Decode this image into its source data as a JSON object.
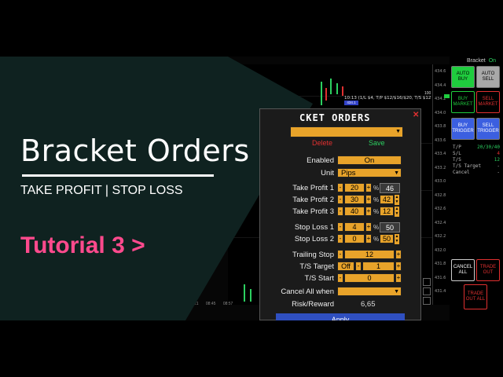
{
  "overlay": {
    "title": "Bracket Orders",
    "subtitle": "TAKE PROFIT | STOP LOSS",
    "tutorial": "Tutorial 3 >",
    "tutorial_color": "#ff4a8d",
    "bg_color": "#0f2220"
  },
  "chart": {
    "status_line": "10:13 (1/L $4, T/P $12/$16/$20, T/S $12",
    "tag": "434.1",
    "price_100": "100",
    "prices": [
      "434.6",
      "434.4",
      "434.2",
      "434.0",
      "433.8",
      "433.6",
      "433.4",
      "433.2",
      "433.0",
      "432.8",
      "432.6",
      "432.4",
      "432.2",
      "432.0",
      "431.8",
      "431.6",
      "431.4"
    ],
    "times": [
      "08:21",
      "08:45",
      "08:57"
    ]
  },
  "right_panel": {
    "title": "Bracket",
    "status": "On",
    "buttons": {
      "auto_buy": "AUTO BUY",
      "auto_sell": "AUTO SELL",
      "buy_market": "BUY MARKET",
      "sell_market": "SELL MARKET",
      "buy_trigger": "BUY TRIGGER",
      "sell_trigger": "SELL TRIGGER",
      "cancel_all": "CANCEL ALL",
      "trade_out": "TRADE OUT",
      "trade_out_all": "TRADE OUT ALL"
    },
    "info": [
      {
        "label": "T/P",
        "value": "20/30/40"
      },
      {
        "label": "S/L",
        "value": "4"
      },
      {
        "label": "T/S",
        "value": "12"
      },
      {
        "label": "T/S Target",
        "value": "-"
      },
      {
        "label": "Cancel",
        "value": "-"
      }
    ],
    "colors": {
      "green": "#1fcc3e",
      "red": "#e03030",
      "blue": "#3b5fe0",
      "grey": "#a8a8a8"
    }
  },
  "dialog": {
    "title": "CKET ORDERS",
    "close": "✕",
    "delete_label": "Delete",
    "save_label": "Save",
    "enabled_label": "Enabled",
    "enabled_value": "On",
    "unit_label": "Unit",
    "unit_value": "Pips",
    "take_profits": [
      {
        "label": "Take Profit 1",
        "value": "20",
        "pct": "46"
      },
      {
        "label": "Take Profit 2",
        "value": "30",
        "pct": "42"
      },
      {
        "label": "Take Profit 3",
        "value": "40",
        "pct": "12"
      }
    ],
    "stop_losses": [
      {
        "label": "Stop Loss 1",
        "value": "4",
        "pct": "50"
      },
      {
        "label": "Stop Loss 2",
        "value": "0",
        "pct": "50"
      }
    ],
    "trailing_stop_label": "Trailing Stop",
    "trailing_stop_value": "12",
    "ts_target_label": "T/S Target",
    "ts_target_off": "Off",
    "ts_target_value": "1",
    "ts_start_label": "T/S Start",
    "ts_start_value": "0",
    "cancel_all_label": "Cancel All when",
    "cancel_all_value": "",
    "risk_reward_label": "Risk/Reward",
    "risk_reward_value": "6,65",
    "apply_label": "Apply",
    "minus": "-",
    "plus": "+",
    "percent": "%",
    "dropdown_icon": "▼"
  }
}
